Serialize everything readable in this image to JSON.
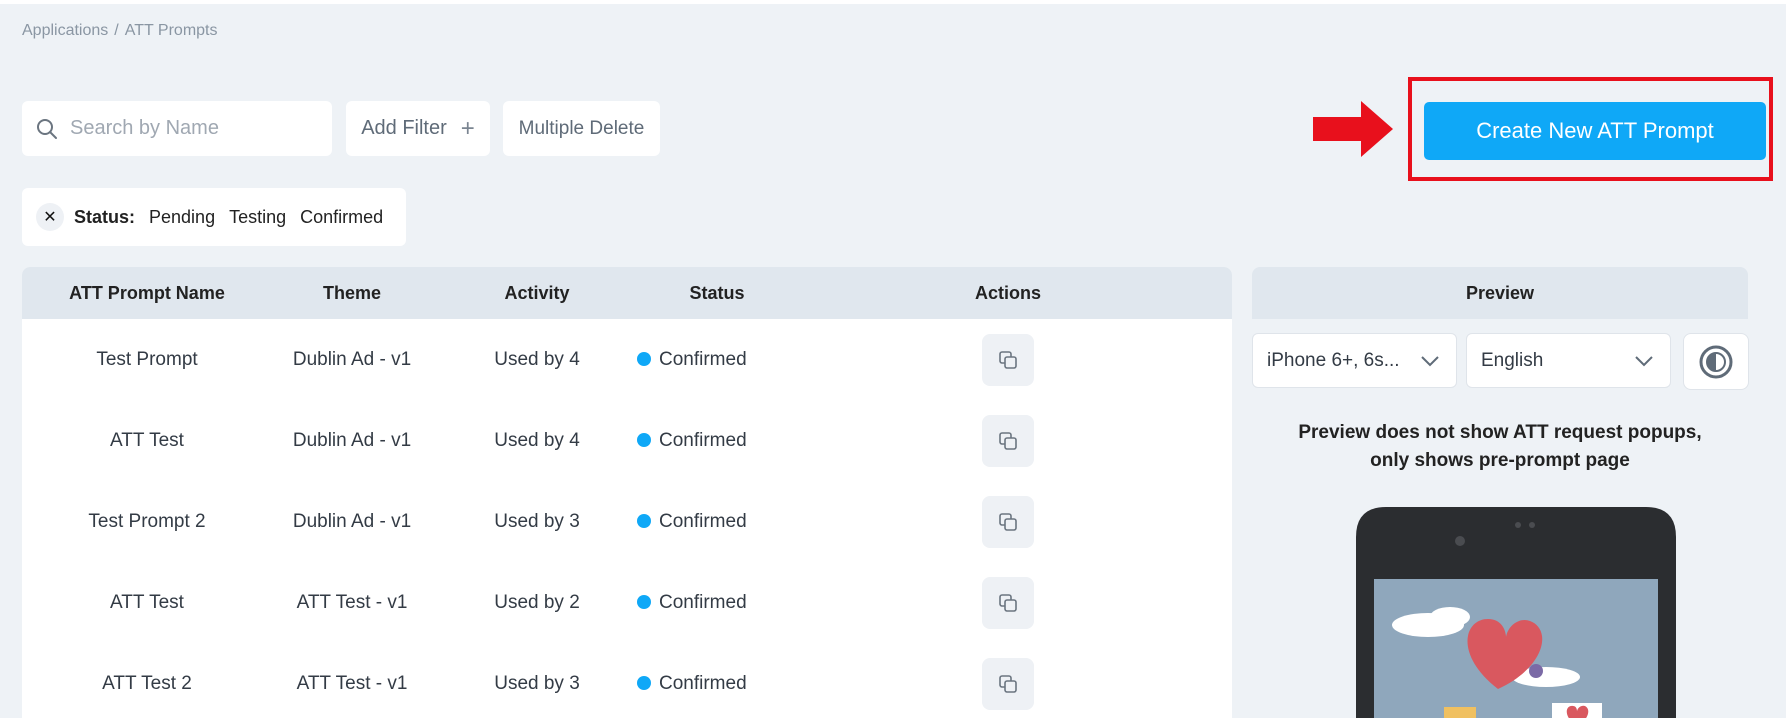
{
  "breadcrumb": {
    "parent": "Applications",
    "separator": "/",
    "current": "ATT Prompts"
  },
  "search": {
    "placeholder": "Search by Name",
    "value": ""
  },
  "toolbar": {
    "add_filter_label": "Add Filter",
    "add_filter_icon": "plus-icon",
    "multiple_delete_label": "Multiple Delete"
  },
  "create_button": {
    "label": "Create New ATT Prompt",
    "color": "#0fa8f7"
  },
  "annotation": {
    "highlight_color": "#e8101c",
    "arrow_color": "#e8101c"
  },
  "status_filter": {
    "label": "Status:",
    "values": [
      "Pending",
      "Testing",
      "Confirmed"
    ]
  },
  "table": {
    "columns": [
      "ATT Prompt Name",
      "Theme",
      "Activity",
      "Status",
      "Actions"
    ],
    "rows": [
      {
        "name": "Test Prompt",
        "theme": "Dublin Ad - v1",
        "activity": "Used by 4",
        "status": "Confirmed"
      },
      {
        "name": "ATT Test",
        "theme": "Dublin Ad - v1",
        "activity": "Used by 4",
        "status": "Confirmed"
      },
      {
        "name": "Test Prompt 2",
        "theme": "Dublin Ad - v1",
        "activity": "Used by 3",
        "status": "Confirmed"
      },
      {
        "name": "ATT Test",
        "theme": "ATT Test - v1",
        "activity": "Used by 2",
        "status": "Confirmed"
      },
      {
        "name": "ATT Test 2",
        "theme": "ATT Test - v1",
        "activity": "Used by 3",
        "status": "Confirmed"
      }
    ],
    "status_color": "#0fa8f7",
    "action_icon": "copy-icon"
  },
  "preview": {
    "title": "Preview",
    "device_select": "iPhone 6+, 6s...",
    "language_select": "English",
    "note_line1": "Preview does not show ATT request popups,",
    "note_line2": "only shows pre-prompt page"
  }
}
